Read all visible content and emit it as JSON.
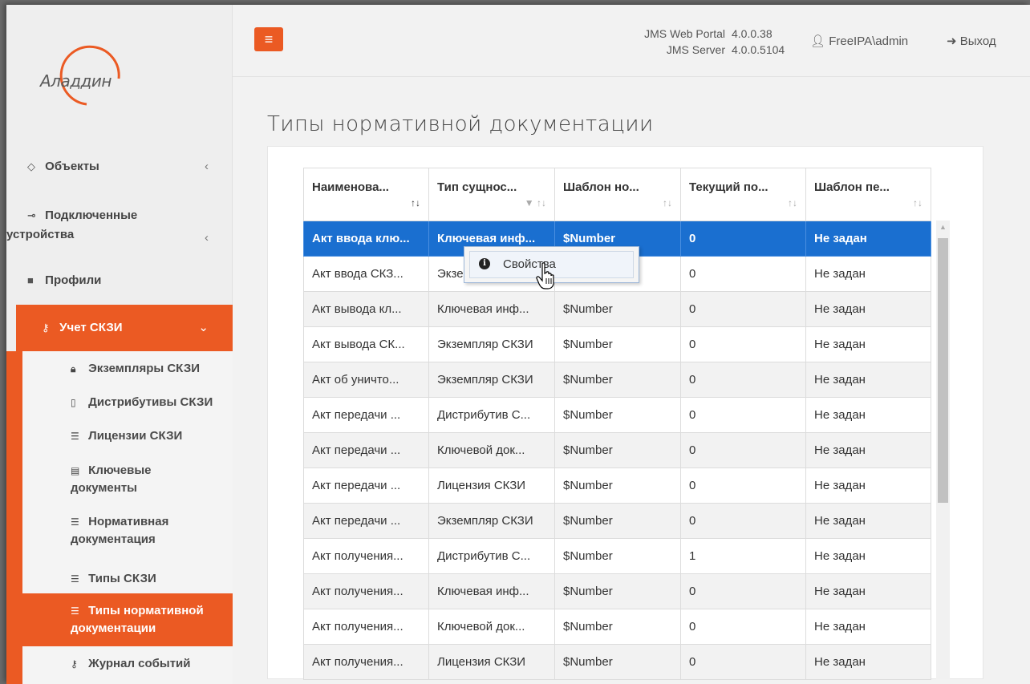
{
  "header": {
    "menu_icon": "hamburger-icon",
    "portal_label": "JMS Web Portal",
    "portal_version": "4.0.0.38",
    "server_label": "JMS Server",
    "server_version": "4.0.0.5104",
    "user": "FreeIPA\\admin",
    "logout": "Выход"
  },
  "logo": {
    "text": "Аладдин"
  },
  "sidebar": {
    "items": [
      {
        "label": "Объекты",
        "icon": "diamond-icon"
      },
      {
        "label": "Подключенные",
        "label2": "устройства",
        "icon": "usb-icon"
      },
      {
        "label": "Профили",
        "icon": "folder-icon"
      },
      {
        "label": "Учет СКЗИ",
        "icon": "key-icon"
      }
    ],
    "sub_items": [
      {
        "label": "Экземпляры СКЗИ",
        "icon": "lock-icon"
      },
      {
        "label": "Дистрибутивы СКЗИ",
        "icon": "file-archive-icon"
      },
      {
        "label": "Лицензии СКЗИ",
        "icon": "list-icon"
      },
      {
        "label": "Ключевые",
        "label2": "документы",
        "icon": "file-text-icon"
      },
      {
        "label": "Нормативная",
        "label2": "документация",
        "icon": "list-icon"
      },
      {
        "label": "Типы СКЗИ",
        "icon": "list-alt-icon"
      },
      {
        "label": "Типы нормативной",
        "label2": "документации",
        "icon": "list-ul-icon"
      },
      {
        "label": "Журнал событий",
        "icon": "key-icon"
      }
    ]
  },
  "page": {
    "title": "Типы нормативной документации"
  },
  "table": {
    "columns": [
      "Наименова...",
      "Тип сущнос...",
      "Шаблон но...",
      "Текущий по...",
      "Шаблон пе..."
    ],
    "rows": [
      [
        "Акт ввода клю...",
        "Ключевая инф...",
        "$Number",
        "0",
        "Не задан"
      ],
      [
        "Акт ввода СКЗ...",
        "Экзе",
        "",
        "0",
        "Не задан"
      ],
      [
        "Акт вывода кл...",
        "Ключевая инф...",
        "$Number",
        "0",
        "Не задан"
      ],
      [
        "Акт вывода СК...",
        "Экземпляр СКЗИ",
        "$Number",
        "0",
        "Не задан"
      ],
      [
        "Акт об уничто...",
        "Экземпляр СКЗИ",
        "$Number",
        "0",
        "Не задан"
      ],
      [
        "Акт передачи ...",
        "Дистрибутив С...",
        "$Number",
        "0",
        "Не задан"
      ],
      [
        "Акт передачи ...",
        "Ключевой док...",
        "$Number",
        "0",
        "Не задан"
      ],
      [
        "Акт передачи ...",
        "Лицензия СКЗИ",
        "$Number",
        "0",
        "Не задан"
      ],
      [
        "Акт передачи ...",
        "Экземпляр СКЗИ",
        "$Number",
        "0",
        "Не задан"
      ],
      [
        "Акт получения...",
        "Дистрибутив С...",
        "$Number",
        "1",
        "Не задан"
      ],
      [
        "Акт получения...",
        "Ключевая инф...",
        "$Number",
        "0",
        "Не задан"
      ],
      [
        "Акт получения...",
        "Ключевой док...",
        "$Number",
        "0",
        "Не задан"
      ],
      [
        "Акт получения...",
        "Лицензия СКЗИ",
        "$Number",
        "0",
        "Не задан"
      ]
    ],
    "selected_row": 0
  },
  "context_menu": {
    "item": "Свойства",
    "icon": "info-icon"
  },
  "colors": {
    "accent": "#eb5a23",
    "selection": "#1a6fd0"
  }
}
